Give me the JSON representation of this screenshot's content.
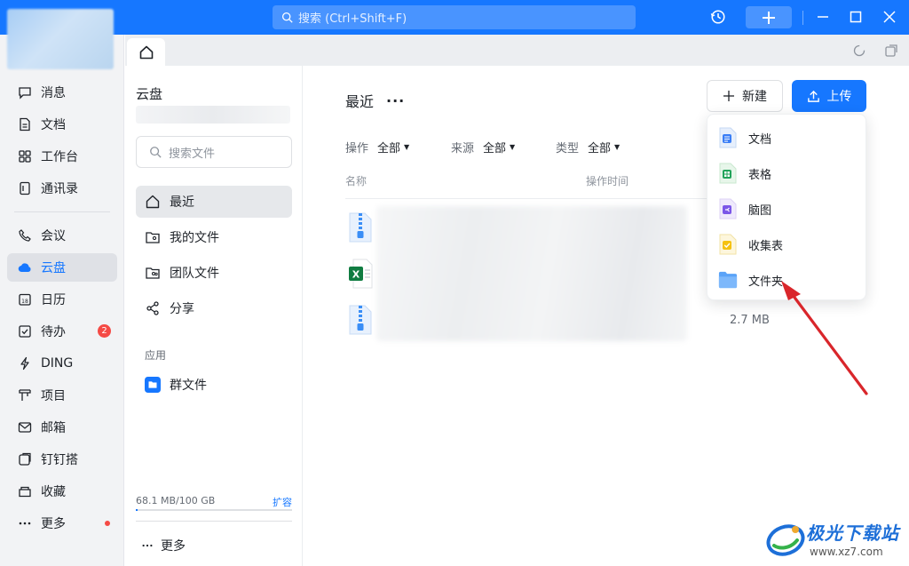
{
  "titlebar": {
    "search_placeholder": "搜索 (Ctrl+Shift+F)"
  },
  "leftnav": {
    "items": [
      {
        "label": "消息",
        "icon": "message-icon"
      },
      {
        "label": "文档",
        "icon": "document-icon"
      },
      {
        "label": "工作台",
        "icon": "workbench-icon"
      },
      {
        "label": "通讯录",
        "icon": "contacts-icon"
      },
      {
        "label": "会议",
        "icon": "phone-icon"
      },
      {
        "label": "云盘",
        "icon": "cloud-icon",
        "active": true
      },
      {
        "label": "日历",
        "icon": "calendar-icon"
      },
      {
        "label": "待办",
        "icon": "todo-icon",
        "badge": "2"
      },
      {
        "label": "DING",
        "icon": "lightning-icon"
      },
      {
        "label": "项目",
        "icon": "project-icon"
      },
      {
        "label": "邮箱",
        "icon": "mail-icon"
      },
      {
        "label": "钉钉搭",
        "icon": "build-icon"
      },
      {
        "label": "收藏",
        "icon": "favorite-icon"
      },
      {
        "label": "更多",
        "icon": "more-icon"
      }
    ]
  },
  "sidebar": {
    "title": "云盘",
    "search_placeholder": "搜索文件",
    "items": [
      {
        "label": "最近",
        "icon": "home-icon",
        "active": true
      },
      {
        "label": "我的文件",
        "icon": "my-files-icon"
      },
      {
        "label": "团队文件",
        "icon": "team-files-icon"
      },
      {
        "label": "分享",
        "icon": "share-icon"
      }
    ],
    "section_label": "应用",
    "apps": [
      {
        "label": "群文件",
        "icon": "group-files-icon"
      }
    ],
    "storage": {
      "text": "68.1 MB/100 GB",
      "expand_label": "扩容",
      "used_fraction": 0.0007
    },
    "more_label": "更多"
  },
  "main": {
    "title": "最近",
    "more_label": "···",
    "new_button": "新建",
    "upload_button": "上传",
    "filters": [
      {
        "label": "操作",
        "value": "全部"
      },
      {
        "label": "来源",
        "value": "全部"
      },
      {
        "label": "类型",
        "value": "全部"
      }
    ],
    "columns": [
      "名称",
      "操作时间"
    ],
    "files": [
      {
        "type": "zip-icon"
      },
      {
        "type": "excel-icon"
      },
      {
        "type": "zip-icon",
        "size": "2.7 MB"
      }
    ]
  },
  "new_menu": {
    "items": [
      {
        "label": "文档",
        "icon": "doc-file-icon"
      },
      {
        "label": "表格",
        "icon": "sheet-file-icon"
      },
      {
        "label": "脑图",
        "icon": "mindmap-file-icon"
      },
      {
        "label": "收集表",
        "icon": "form-file-icon"
      },
      {
        "label": "文件夹",
        "icon": "folder-icon"
      }
    ]
  },
  "watermark": {
    "title": "极光下载站",
    "url": "www.xz7.com"
  },
  "colors": {
    "accent": "#1677ff",
    "badge": "#f54a45",
    "arrow": "#d9262b"
  }
}
